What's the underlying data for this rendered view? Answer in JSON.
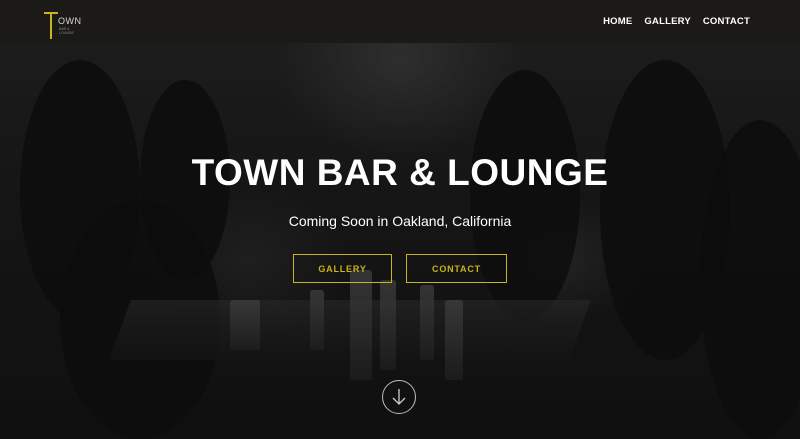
{
  "nav": {
    "logo": {
      "text": "OWN",
      "subtext": "BAR & LOUNGE",
      "accent_color": "#c9b31f"
    },
    "links": [
      {
        "label": "HOME"
      },
      {
        "label": "GALLERY"
      },
      {
        "label": "CONTACT"
      }
    ]
  },
  "hero": {
    "title": "TOWN BAR & LOUNGE",
    "subtitle": "Coming Soon in Oakland, California",
    "buttons": [
      {
        "label": "GALLERY"
      },
      {
        "label": "CONTACT"
      }
    ],
    "scroll_icon": "arrow-down-icon"
  },
  "colors": {
    "accent": "#c9b31f",
    "nav_bg": "#1b1a17",
    "text": "#ffffff"
  }
}
